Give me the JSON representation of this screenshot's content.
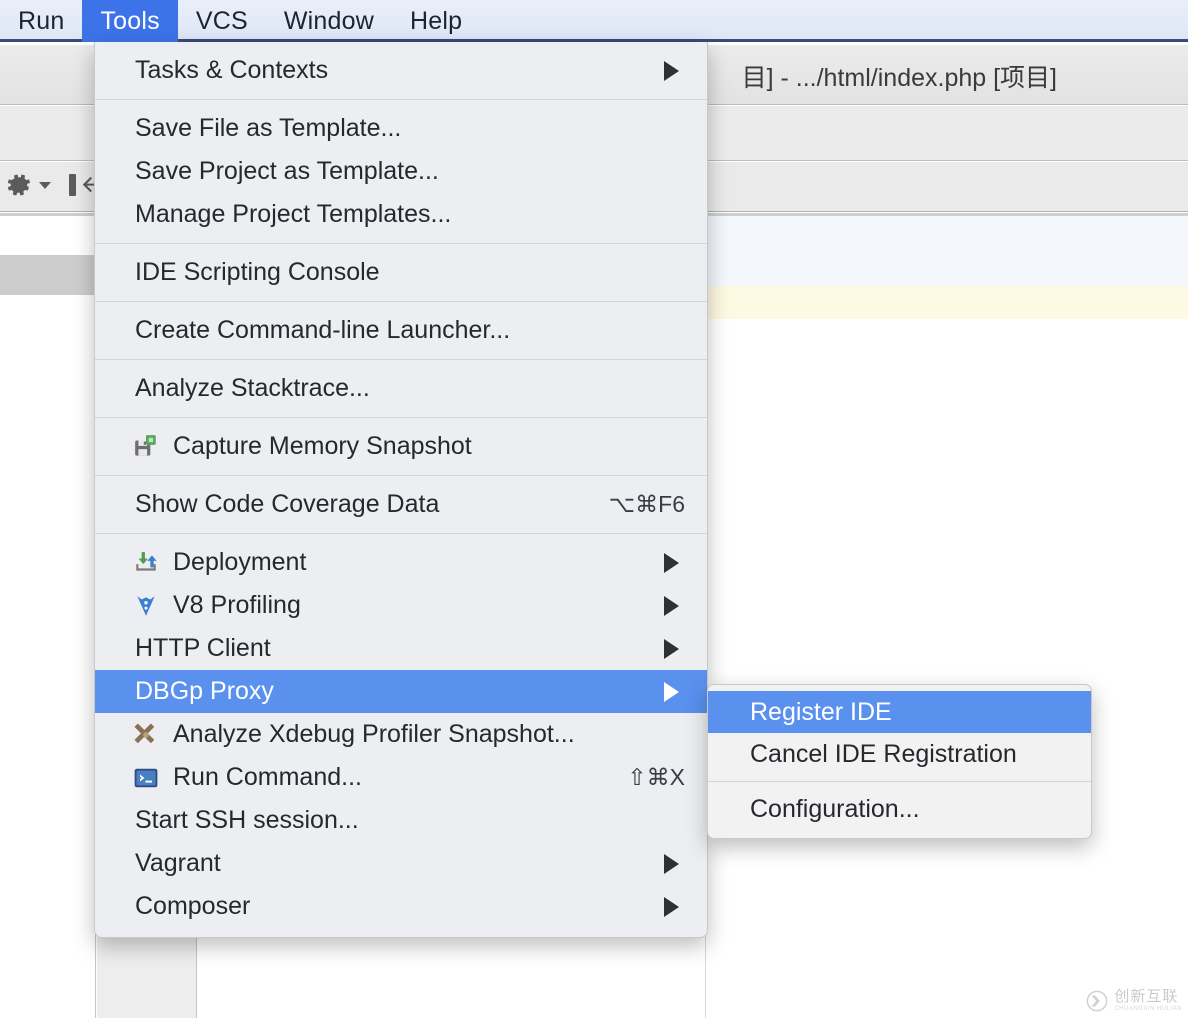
{
  "window": {
    "title": "目] - .../html/index.php [项目]"
  },
  "menubar": {
    "items": [
      {
        "label": "Run",
        "selected": false
      },
      {
        "label": "Tools",
        "selected": true
      },
      {
        "label": "VCS",
        "selected": false
      },
      {
        "label": "Window",
        "selected": false
      },
      {
        "label": "Help",
        "selected": false
      }
    ],
    "selected_accent": "#3d73e8"
  },
  "toolbar": {
    "gear_icon": "gear-icon",
    "gear_dropdown_icon": "chevron-down-icon",
    "collapse_icon": "collapse-all-icon"
  },
  "menu": {
    "name": "Tools",
    "highlight_color": "#5a90ee",
    "groups": [
      {
        "items": [
          {
            "label": "Tasks & Contexts",
            "submenu": true,
            "shortcut": "",
            "icon": "",
            "selected": false
          }
        ]
      },
      {
        "items": [
          {
            "label": "Save File as Template...",
            "submenu": false,
            "shortcut": "",
            "icon": "",
            "selected": false
          },
          {
            "label": "Save Project as Template...",
            "submenu": false,
            "shortcut": "",
            "icon": "",
            "selected": false
          },
          {
            "label": "Manage Project Templates...",
            "submenu": false,
            "shortcut": "",
            "icon": "",
            "selected": false
          }
        ]
      },
      {
        "items": [
          {
            "label": "IDE Scripting Console",
            "submenu": false,
            "shortcut": "",
            "icon": "",
            "selected": false
          }
        ]
      },
      {
        "items": [
          {
            "label": "Create Command-line Launcher...",
            "submenu": false,
            "shortcut": "",
            "icon": "",
            "selected": false
          }
        ]
      },
      {
        "items": [
          {
            "label": "Analyze Stacktrace...",
            "submenu": false,
            "shortcut": "",
            "icon": "",
            "selected": false
          }
        ]
      },
      {
        "items": [
          {
            "label": "Capture Memory Snapshot",
            "submenu": false,
            "shortcut": "",
            "icon": "memory-snapshot-icon",
            "selected": false
          }
        ]
      },
      {
        "items": [
          {
            "label": "Show Code Coverage Data",
            "submenu": false,
            "shortcut": "⌥⌘F6",
            "icon": "",
            "selected": false
          }
        ]
      },
      {
        "items": [
          {
            "label": "Deployment",
            "submenu": true,
            "shortcut": "",
            "icon": "deployment-icon",
            "selected": false
          },
          {
            "label": "V8 Profiling",
            "submenu": true,
            "shortcut": "",
            "icon": "v8-profiling-icon",
            "selected": false
          },
          {
            "label": "HTTP Client",
            "submenu": true,
            "shortcut": "",
            "icon": "",
            "selected": false
          },
          {
            "label": "DBGp Proxy",
            "submenu": true,
            "shortcut": "",
            "icon": "",
            "selected": true
          },
          {
            "label": "Analyze Xdebug Profiler Snapshot...",
            "submenu": false,
            "shortcut": "",
            "icon": "xdebug-icon",
            "selected": false
          },
          {
            "label": "Run Command...",
            "submenu": false,
            "shortcut": "⇧⌘X",
            "icon": "terminal-icon",
            "selected": false
          },
          {
            "label": "Start SSH session...",
            "submenu": false,
            "shortcut": "",
            "icon": "",
            "selected": false
          },
          {
            "label": "Vagrant",
            "submenu": true,
            "shortcut": "",
            "icon": "",
            "selected": false
          },
          {
            "label": "Composer",
            "submenu": true,
            "shortcut": "",
            "icon": "",
            "selected": false
          }
        ]
      }
    ]
  },
  "submenu": {
    "parent": "DBGp Proxy",
    "groups": [
      {
        "items": [
          {
            "label": "Register IDE",
            "selected": true
          },
          {
            "label": "Cancel IDE Registration",
            "selected": false
          }
        ]
      },
      {
        "items": [
          {
            "label": "Configuration...",
            "selected": false
          }
        ]
      }
    ]
  },
  "watermark": {
    "cn": "创新互联",
    "en": "CHUANGXIN HULIAN"
  }
}
